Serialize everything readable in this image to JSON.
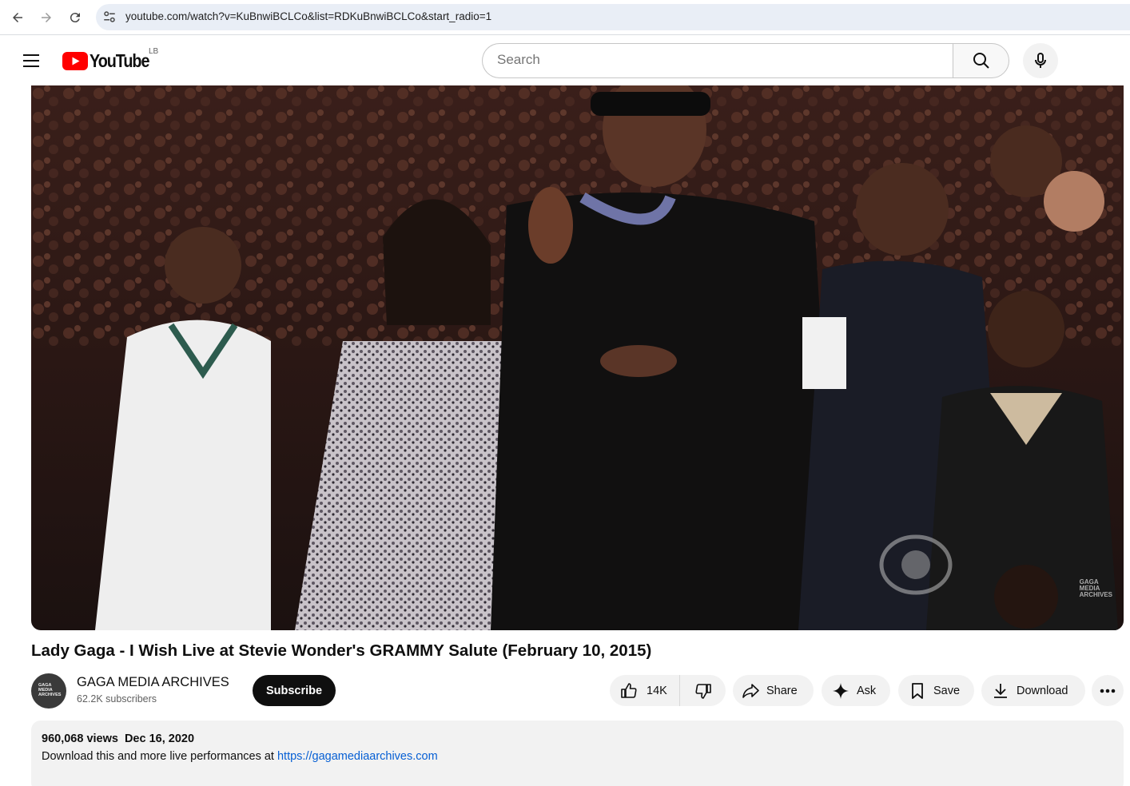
{
  "browser": {
    "url": "youtube.com/watch?v=KuBnwiBCLCo&list=RDKuBnwiBCLCo&start_radio=1"
  },
  "masthead": {
    "logo_text": "YouTube",
    "region_code": "LB",
    "search_placeholder": "Search"
  },
  "video": {
    "watermark_lines": [
      "GAGA",
      "MEDIA",
      "ARCHIVES"
    ],
    "title": "Lady Gaga - I Wish Live at Stevie Wonder's GRAMMY Salute (February 10, 2015)"
  },
  "channel": {
    "name": "GAGA MEDIA ARCHIVES",
    "subscribers": "62.2K subscribers",
    "avatar_text": "GAGA MEDIA ARCHIVES",
    "subscribe_label": "Subscribe"
  },
  "actions": {
    "like_count": "14K",
    "share_label": "Share",
    "ask_label": "Ask",
    "save_label": "Save",
    "download_label": "Download"
  },
  "description": {
    "views": "960,068 views",
    "date": "Dec 16, 2020",
    "text": "Download this and more live performances at ",
    "link": "https://gagamediaarchives.com"
  },
  "colors": {
    "youtube_red": "#ff0000",
    "link_blue": "#065fd4",
    "subscribe_bg": "#0f0f0f",
    "pill_bg": "#f2f2f2"
  },
  "icons": [
    "back-arrow-icon",
    "forward-arrow-icon",
    "reload-icon",
    "site-info-icon",
    "hamburger-menu-icon",
    "youtube-play-icon",
    "search-icon",
    "microphone-icon",
    "thumbs-up-icon",
    "thumbs-down-icon",
    "share-arrow-icon",
    "sparkle-icon",
    "bookmark-icon",
    "download-icon",
    "more-dots-icon"
  ]
}
